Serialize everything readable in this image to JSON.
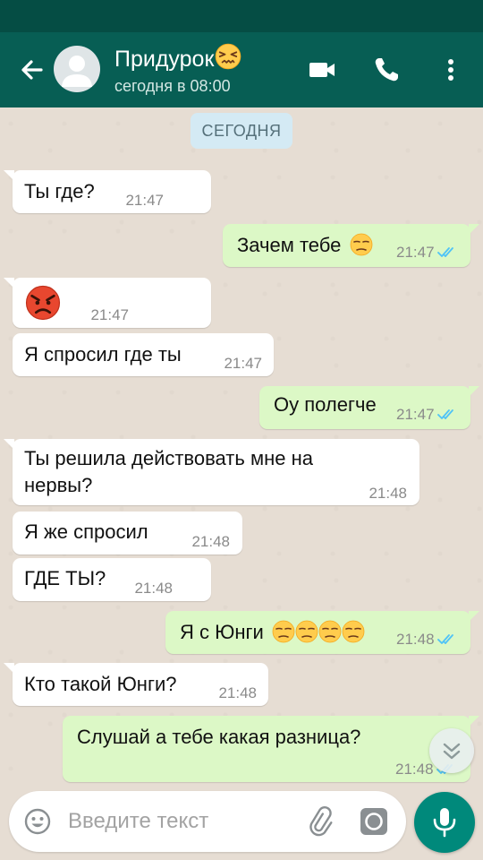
{
  "header": {
    "contact_name": "Придурок",
    "status": "сегодня в 08:00",
    "icons": [
      "back-arrow-icon",
      "avatar",
      "confounded-emoji-icon",
      "video-call-icon",
      "phone-icon",
      "more-vert-icon"
    ]
  },
  "chat": {
    "date_chip": "СЕГОДНЯ",
    "messages": [
      {
        "dir": "in",
        "text": "Ты где?",
        "time": "21:47"
      },
      {
        "dir": "out",
        "text": "Зачем тебе",
        "emoji": [
          "unamused"
        ],
        "time": "21:47",
        "read": true
      },
      {
        "dir": "in",
        "text": "",
        "emoji": [
          "angry"
        ],
        "time": "21:47"
      },
      {
        "dir": "in",
        "text": "Я спросил где ты",
        "time": "21:47"
      },
      {
        "dir": "out",
        "text": "Оу полегче",
        "time": "21:47",
        "read": true
      },
      {
        "dir": "in",
        "text": "Ты решила действовать мне на",
        "text2": "нервы?",
        "time": "21:48"
      },
      {
        "dir": "in",
        "text": "Я же спросил",
        "time": "21:48"
      },
      {
        "dir": "in",
        "text": "ГДЕ ТЫ?",
        "time": "21:48"
      },
      {
        "dir": "out",
        "text": "Я с Юнги",
        "emoji": [
          "unamused",
          "unamused",
          "unamused",
          "unamused"
        ],
        "time": "21:48",
        "read": true
      },
      {
        "dir": "in",
        "text": "Кто такой Юнги?",
        "time": "21:48"
      },
      {
        "dir": "out",
        "text": "Слушай а тебе какая разница?",
        "time": "21:48",
        "read": true
      }
    ]
  },
  "composer": {
    "placeholder": "Введите текст",
    "icons": [
      "emoji-icon",
      "attach-icon",
      "camera-icon",
      "mic-icon"
    ]
  },
  "colors": {
    "status_bar": "#054d44",
    "app_bar": "#075e54",
    "outgoing_bubble": "#dcf8c6",
    "incoming_bubble": "#ffffff",
    "read_ticks": "#4fc3f7",
    "mic_button": "#00897b"
  }
}
